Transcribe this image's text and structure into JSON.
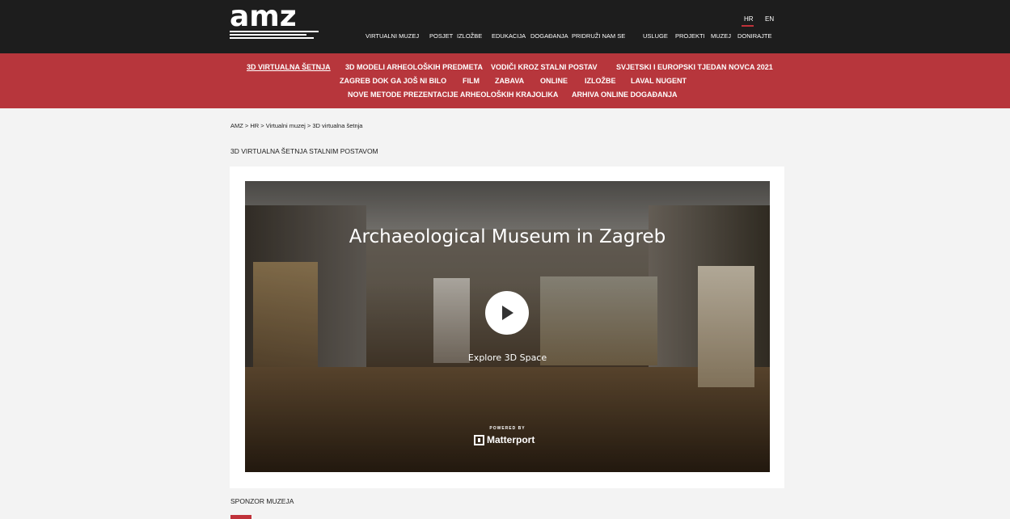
{
  "header": {
    "logo_text": "amz",
    "lang": [
      "HR",
      "EN"
    ],
    "main_nav": [
      "VIRTUALNI MUZEJ",
      "POSJET",
      "IZLOŽBE",
      "EDUKACIJA",
      "DOGAĐANJA",
      "PRIDRUŽI NAM SE",
      "USLUGE",
      "PROJEKTI",
      "MUZEJ",
      "DONIRAJTE"
    ]
  },
  "subnav": {
    "row1": [
      "3D VIRTUALNA ŠETNJA",
      "3D MODELI ARHEOLOŠKIH PREDMETA",
      "VODIČI KROZ STALNI POSTAV",
      "SVJETSKI I EUROPSKI TJEDAN NOVCA 2021"
    ],
    "row2": [
      "ZAGREB DOK GA JOŠ NI BILO",
      "FILM",
      "ZABAVA",
      "ONLINE",
      "IZLOŽBE",
      "LAVAL NUGENT"
    ],
    "row3": [
      "NOVE METODE PREZENTACIJE ARHEOLOŠKIH KRAJOLIKA",
      "ARHIVA ONLINE DOGAĐANJA"
    ]
  },
  "breadcrumb": "AMZ > HR > Virtualni muzej > 3D virtualna šetnja",
  "page_heading": "3D VIRTUALNA ŠETNJA STALNIM POSTAVOM",
  "viewer": {
    "title": "Archaeological Museum in Zagreb",
    "explore": "Explore 3D Space",
    "powered": "POWERED BY",
    "brand": "Matterport"
  },
  "sponsor_heading": "SPONZOR MUZEJA",
  "colors": {
    "topbar": "#1d1d1d",
    "accent": "#b7363c"
  }
}
